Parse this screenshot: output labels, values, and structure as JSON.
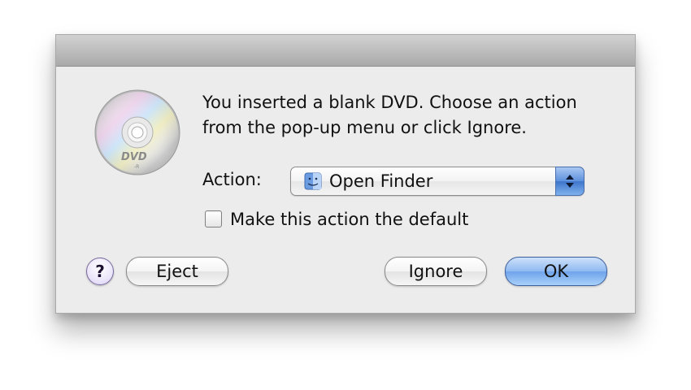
{
  "dialog": {
    "message_line1": "You inserted a blank DVD. Choose an action",
    "message_line2": "from the pop-up menu or click Ignore.",
    "disc_icon": "dvd-r-disc-icon",
    "disc_badge": "DVD"
  },
  "action": {
    "label": "Action:",
    "selected_value": "Open Finder",
    "selected_icon": "finder-icon",
    "arrows_icon": "updown-arrows-icon"
  },
  "default_checkbox": {
    "label": "Make this action the default",
    "checked": false
  },
  "buttons": {
    "help_label": "?",
    "eject_label": "Eject",
    "ignore_label": "Ignore",
    "ok_label": "OK"
  },
  "colors": {
    "default_button": "#8fb9f1",
    "popup_arrows": "#5e91dd",
    "help_button": "#ece6fa"
  }
}
